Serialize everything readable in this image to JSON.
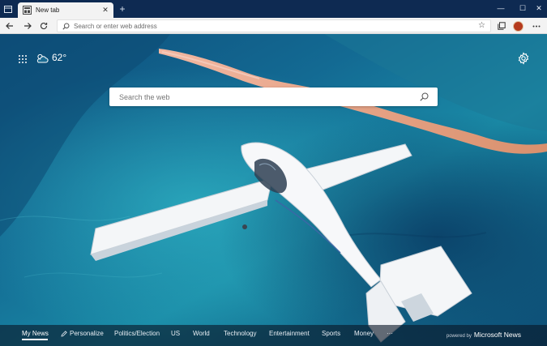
{
  "browser": {
    "tab": {
      "title": "New tab",
      "close_glyph": "✕"
    },
    "new_tab_glyph": "+",
    "window_controls": {
      "minimize": "—",
      "maximize": "☐",
      "close": "✕"
    },
    "address_bar": {
      "placeholder": "Search or enter web address",
      "value": ""
    },
    "toolbar_icons": [
      "back-arrow-icon",
      "forward-arrow-icon",
      "refresh-icon",
      "favorites-star-icon",
      "collections-icon",
      "profile-avatar",
      "more-icon"
    ]
  },
  "new_tab_page": {
    "weather": {
      "temperature": "62°",
      "icon": "partly-cloudy-icon"
    },
    "search": {
      "placeholder": "Search the web",
      "value": ""
    },
    "news_nav": {
      "items": [
        {
          "label": "My News",
          "active": true
        },
        {
          "label": "Personalize",
          "icon": "pencil-icon"
        },
        {
          "label": "Politics/Election"
        },
        {
          "label": "US"
        },
        {
          "label": "World"
        },
        {
          "label": "Technology"
        },
        {
          "label": "Entertainment"
        },
        {
          "label": "Sports"
        },
        {
          "label": "Money"
        },
        {
          "label": "···"
        }
      ],
      "powered_by_small": "powered by",
      "powered_by_brand": "Microsoft News"
    }
  },
  "colors": {
    "titlebar": "#0e2a52",
    "toolbar": "#f3f3f3",
    "ocean_deep": "#0d4d7a",
    "ocean_shallow": "#27a6b8"
  }
}
